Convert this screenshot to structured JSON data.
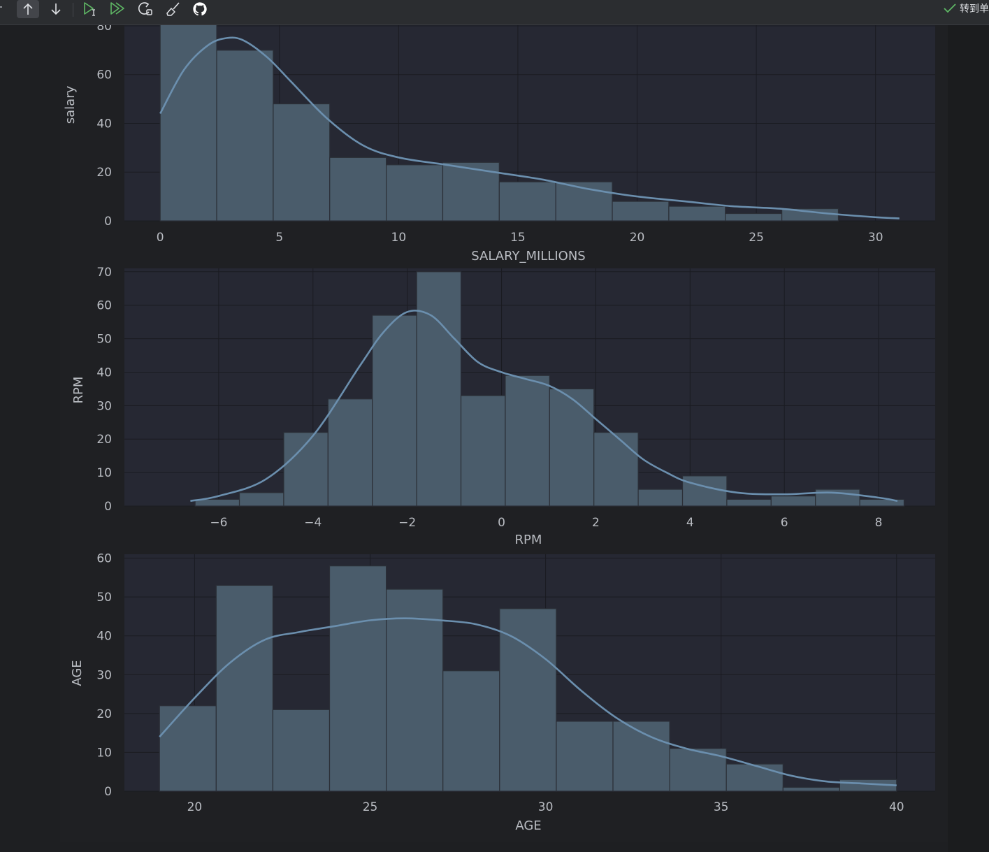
{
  "toolbar": {
    "buttons": [
      {
        "icon": "arrow-up-icon",
        "active": true
      },
      {
        "icon": "arrow-down-icon",
        "active": false
      },
      {
        "icon": "run-cell-select-below-icon",
        "active": false
      },
      {
        "icon": "run-all-icon",
        "active": false
      },
      {
        "icon": "restart-kernel-icon",
        "active": false
      },
      {
        "icon": "clear-outputs-icon",
        "active": false
      },
      {
        "icon": "github-icon",
        "active": false
      }
    ],
    "status_text": "转到单",
    "status_icon": "checkmark-icon",
    "accent_green": "#5fb865"
  },
  "chart_data": [
    {
      "type": "bar",
      "subtype": "histogram-with-kde",
      "xlabel": "SALARY_MILLIONS",
      "ylabel": "salary",
      "xlim": [
        -1.5,
        32.5
      ],
      "ylim": [
        0,
        82
      ],
      "xticks": [
        0,
        5,
        10,
        15,
        20,
        25,
        30
      ],
      "xtick_labels": [
        "0",
        "5",
        "10",
        "15",
        "20",
        "25",
        "30"
      ],
      "yticks": [
        0,
        20,
        40,
        60,
        80
      ],
      "ytick_labels": [
        "0",
        "20",
        "40",
        "60",
        "80"
      ],
      "bin_edges": [
        0,
        2.37,
        4.74,
        7.11,
        9.48,
        11.85,
        14.22,
        16.59,
        18.96,
        21.33,
        23.7,
        26.07,
        28.44,
        30.81
      ],
      "values": [
        85,
        70,
        48,
        26,
        23,
        24,
        16,
        16,
        8,
        6,
        3,
        5,
        0
      ],
      "kde": {
        "x": [
          0,
          1,
          2,
          2.8,
          3.5,
          4.5,
          5.5,
          7,
          8.5,
          10,
          12,
          14,
          16,
          18,
          20,
          22,
          24,
          26,
          28,
          30,
          31
        ],
        "y": [
          44,
          62,
          72,
          75,
          74,
          67,
          57,
          42,
          31,
          26,
          23,
          20,
          17,
          13,
          10,
          8,
          6,
          5,
          3,
          1.5,
          1
        ]
      },
      "grid": true,
      "colors": {
        "bar": "#4a5c6b",
        "kde": "#6b8fae",
        "axes_bg": "#262833"
      }
    },
    {
      "type": "bar",
      "subtype": "histogram-with-kde",
      "xlabel": "RPM",
      "ylabel": "RPM",
      "xlim": [
        -8,
        9.2
      ],
      "ylim": [
        0,
        71
      ],
      "xticks": [
        -6,
        -4,
        -2,
        0,
        2,
        4,
        6,
        8
      ],
      "xtick_labels": [
        "−6",
        "−4",
        "−2",
        "0",
        "2",
        "4",
        "6",
        "8"
      ],
      "yticks": [
        0,
        10,
        20,
        30,
        40,
        50,
        60,
        70
      ],
      "ytick_labels": [
        "0",
        "10",
        "20",
        "30",
        "40",
        "50",
        "60",
        "70"
      ],
      "bin_edges": [
        -6.5,
        -5.56,
        -4.62,
        -3.68,
        -2.74,
        -1.8,
        -0.86,
        0.08,
        1.02,
        1.96,
        2.9,
        3.84,
        4.78,
        5.72,
        6.66,
        7.6,
        8.54
      ],
      "values": [
        2,
        4,
        22,
        32,
        57,
        70,
        33,
        39,
        35,
        22,
        5,
        9,
        2,
        3,
        5,
        2
      ],
      "kde": {
        "x": [
          -6.6,
          -6,
          -5,
          -4,
          -3,
          -2.5,
          -2,
          -1.5,
          -1,
          -0.5,
          0,
          0.5,
          1,
          1.5,
          2,
          2.5,
          3,
          3.5,
          4,
          5,
          6,
          7,
          8,
          8.4
        ],
        "y": [
          1.5,
          3,
          8,
          21,
          42,
          52,
          58,
          57,
          50,
          43,
          40,
          38,
          36,
          32,
          26,
          20,
          14,
          10,
          7,
          4,
          3.5,
          4,
          2.5,
          1.5
        ]
      },
      "grid": true,
      "colors": {
        "bar": "#4a5c6b",
        "kde": "#6b8fae",
        "axes_bg": "#262833"
      }
    },
    {
      "type": "bar",
      "subtype": "histogram-with-kde",
      "xlabel": "AGE",
      "ylabel": "AGE",
      "xlim": [
        18,
        41.1
      ],
      "ylim": [
        0,
        61
      ],
      "xticks": [
        20,
        25,
        30,
        35,
        40
      ],
      "xtick_labels": [
        "20",
        "25",
        "30",
        "35",
        "40"
      ],
      "yticks": [
        0,
        10,
        20,
        30,
        40,
        50,
        60
      ],
      "ytick_labels": [
        "0",
        "10",
        "20",
        "30",
        "40",
        "50",
        "60"
      ],
      "bin_edges": [
        19,
        20.615,
        22.23,
        23.845,
        25.46,
        27.075,
        28.69,
        30.305,
        31.92,
        33.535,
        35.15,
        36.765,
        38.38,
        40
      ],
      "values": [
        22,
        53,
        21,
        58,
        52,
        31,
        47,
        18,
        18,
        11,
        7,
        1,
        3
      ],
      "kde": {
        "x": [
          19,
          20,
          21,
          22,
          23,
          24,
          25,
          26,
          27,
          28,
          29,
          30,
          31,
          32,
          33,
          34,
          35,
          36,
          37,
          38,
          39,
          40
        ],
        "y": [
          14,
          24,
          33,
          39,
          41,
          42.5,
          44,
          44.5,
          44,
          43,
          40,
          34,
          26,
          19,
          14,
          11,
          9,
          6.5,
          4,
          2.5,
          2,
          1.5
        ]
      },
      "grid": true,
      "colors": {
        "bar": "#4a5c6b",
        "kde": "#6b8fae",
        "axes_bg": "#262833"
      }
    }
  ]
}
